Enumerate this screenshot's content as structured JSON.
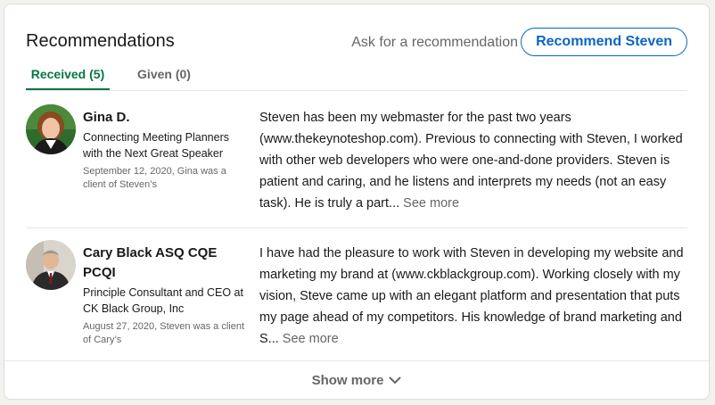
{
  "section": {
    "title": "Recommendations",
    "ask_link": "Ask for a recommendation",
    "recommend_button": "Recommend Steven"
  },
  "tabs": [
    {
      "label": "Received (5)",
      "active": true
    },
    {
      "label": "Given (0)",
      "active": false
    }
  ],
  "recommendations": [
    {
      "name": "Gina D.",
      "headline": "Connecting Meeting Planners with the Next Great Speaker",
      "date_relation": "September 12, 2020, Gina was a client of Steven’s",
      "text": "Steven has been my webmaster for the past two years (www.thekeynoteshop.com). Previous to connecting with Steven, I worked with other web developers who were one-and-done providers. Steven is patient and caring, and he listens and interprets my needs (not an easy task). He is truly a part...",
      "see_more": "See more"
    },
    {
      "name": "Cary Black ASQ CQE PCQI",
      "headline": "Principle Consultant and CEO at CK Black Group, Inc",
      "date_relation": "August 27, 2020, Steven was a client of Cary’s",
      "text": "I have had the pleasure to work with Steven in developing my website and marketing my brand at (www.ckblackgroup.com). Working closely with my vision, Steve came up with an elegant platform and presentation that puts my page ahead of my competitors. His knowledge of brand marketing and S...",
      "see_more": "See more"
    }
  ],
  "show_more": {
    "label": "Show more",
    "icon": "chevron-down-icon"
  },
  "colors": {
    "accent_blue": "#0a66c2",
    "active_tab_green": "#057642",
    "muted_text": "#666666"
  }
}
